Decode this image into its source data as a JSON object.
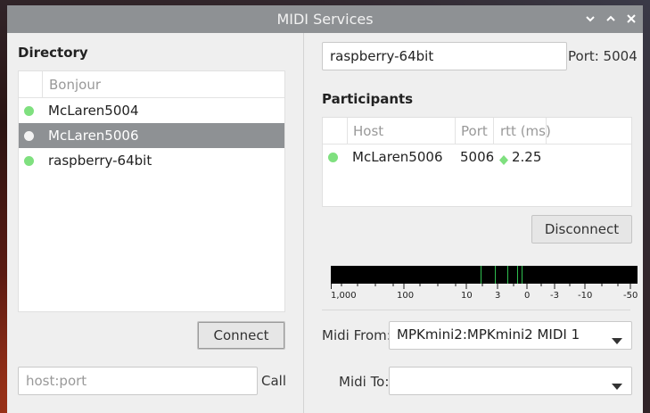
{
  "window": {
    "title": "MIDI Services"
  },
  "directory": {
    "heading": "Directory",
    "column_header": "Bonjour",
    "items": [
      {
        "label": "McLaren5004",
        "selected": false
      },
      {
        "label": "McLaren5006",
        "selected": true
      },
      {
        "label": "raspberry-64bit",
        "selected": false
      }
    ],
    "connect_label": "Connect",
    "host_placeholder": "host:port",
    "call_label": "Call"
  },
  "session": {
    "name_value": "raspberry-64bit",
    "port_label": "Port: 5004"
  },
  "participants": {
    "heading": "Participants",
    "columns": {
      "host": "Host",
      "port": "Port",
      "rtt": "rtt (ms)"
    },
    "rows": [
      {
        "host": "McLaren5006",
        "port": "5006",
        "rtt": "2.25"
      }
    ],
    "disconnect_label": "Disconnect"
  },
  "latency_meter": {
    "scale_labels": [
      "1,000",
      "100",
      "10",
      "3",
      "0",
      "-3",
      "-10",
      "-50"
    ],
    "marker_color": "#2fbf4f"
  },
  "midi": {
    "from_label": "Midi From:",
    "from_value": "MPKmini2:MPKmini2 MIDI 1",
    "to_label": "Midi To:",
    "to_value": ""
  },
  "colors": {
    "status_green": "#7fe07f",
    "titlebar": "#8e9194",
    "selection": "#8e9194"
  }
}
